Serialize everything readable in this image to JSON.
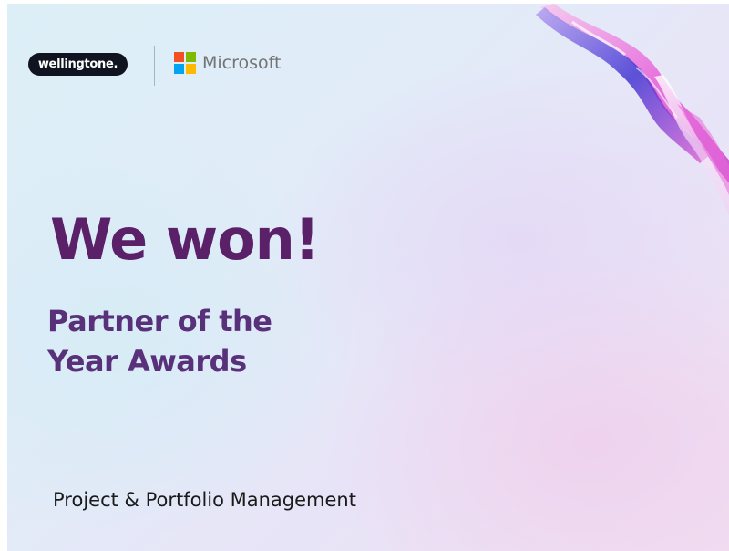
{
  "brand": {
    "partner_logo_text": "wellingtone.",
    "ms_name": "Microsoft",
    "ms_colors": [
      "#f25022",
      "#7fba00",
      "#00a4ef",
      "#ffb900"
    ]
  },
  "headline": "We won!",
  "subheadline": [
    "Partner of the",
    "Year Awards"
  ],
  "category": "Project & Portfolio Management",
  "colors": {
    "headline": "#5a2068",
    "subheadline": "#59317a"
  }
}
